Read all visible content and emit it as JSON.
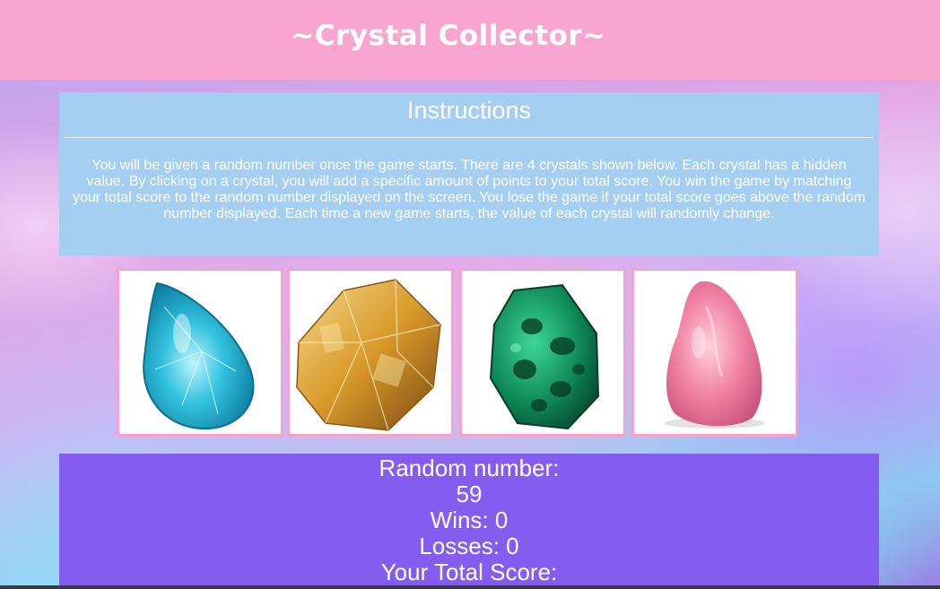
{
  "header": {
    "title": "~Crystal Collector~"
  },
  "instructions": {
    "title": "Instructions",
    "text": "You will be given a random number once the game starts. There are 4 crystals shown below. Each crystal has a hidden value. By clicking on a crystal, you will add a specific amount of points to your total score. You win the game by matching your total score to the random number displayed on the screen. You lose the game if your total score goes above the random number displayed. Each time a new game starts, the value of each crystal will randomly change."
  },
  "crystals": [
    {
      "name": "blue-teardrop-crystal",
      "color": "#23b3d4"
    },
    {
      "name": "amber-crystal-cluster",
      "color": "#d99a2b"
    },
    {
      "name": "green-malachite-crystal",
      "color": "#0f8a5a"
    },
    {
      "name": "pink-rose-crystal",
      "color": "#f17fa3"
    }
  ],
  "scoreboard": {
    "random_label": "Random number:",
    "random_value": "59",
    "wins": "Wins: 0",
    "losses": "Losses: 0",
    "total_label": "Your Total Score:"
  },
  "colors": {
    "header_bg": "#f8a6d0",
    "instructions_bg": "#a4cff2",
    "scoreboard_bg": "#845df0",
    "crystal_border": "#f5a3cd"
  }
}
